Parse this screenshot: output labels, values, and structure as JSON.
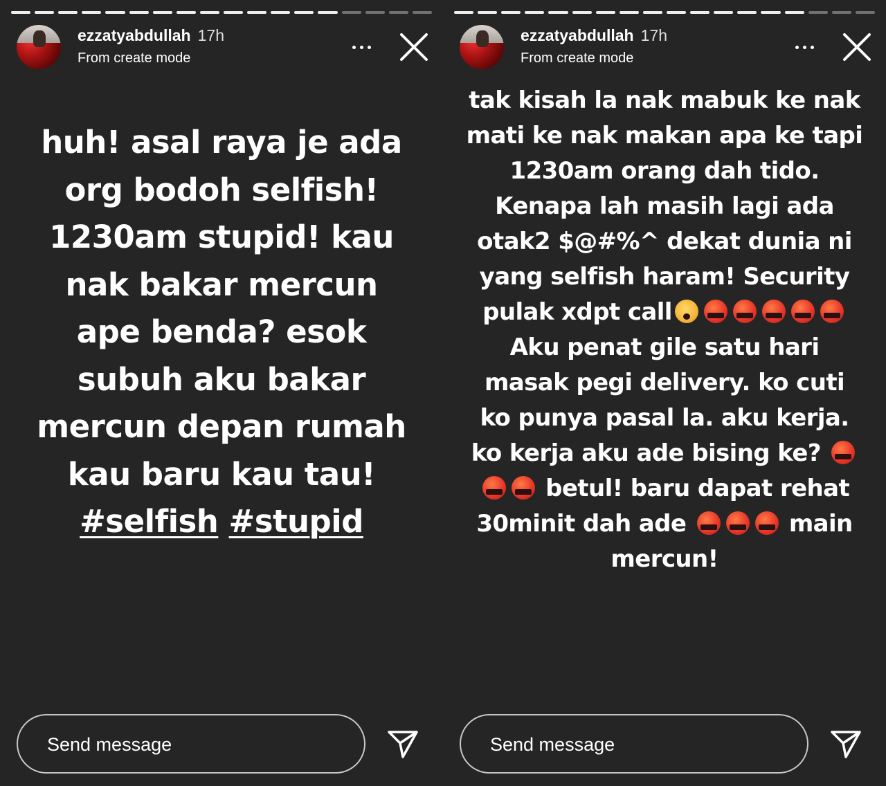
{
  "stories": [
    {
      "progress": {
        "seen": 14,
        "total": 18
      },
      "header": {
        "username": "ezzatyabdullah",
        "timestamp": "17h",
        "subtitle": "From create mode"
      },
      "text_lines": [
        "huh! asal raya je ada",
        "org bodoh selfish!",
        "1230am stupid! kau",
        "nak bakar mercun",
        "ape benda? esok",
        "subuh aku bakar",
        "mercun depan rumah",
        "kau baru kau tau!"
      ],
      "hashtags": [
        "#selfish",
        "#stupid"
      ],
      "composer": {
        "placeholder": "Send message"
      }
    },
    {
      "progress": {
        "seen": 15,
        "total": 18
      },
      "header": {
        "username": "ezzatyabdullah",
        "timestamp": "17h",
        "subtitle": "From create mode"
      },
      "text_lines": [
        "tak kisah la nak mabuk ke nak",
        "mati ke nak makan apa ke tapi",
        "1230am orang dah tido.",
        "Kenapa lah masih lagi ada",
        "otak2 $@#%^ dekat dunia ni",
        "yang selfish haram! Security",
        "pulak xdpt call",
        "Aku penat gile satu hari",
        "masak pegi delivery. ko cuti",
        "ko punya pasal la. aku kerja.",
        "ko kerja aku ade bising ke?",
        "betul! baru dapat rehat",
        "30minit dah ade",
        "main",
        "mercun!"
      ],
      "emoji_icons": [
        "exploding-head-icon",
        "cursing-face-icon"
      ],
      "composer": {
        "placeholder": "Send message"
      }
    }
  ],
  "colors": {
    "background": "#252525",
    "text": "#ffffff",
    "cursing_face": "#e8382a",
    "exploding_head": "#f4b53a"
  }
}
